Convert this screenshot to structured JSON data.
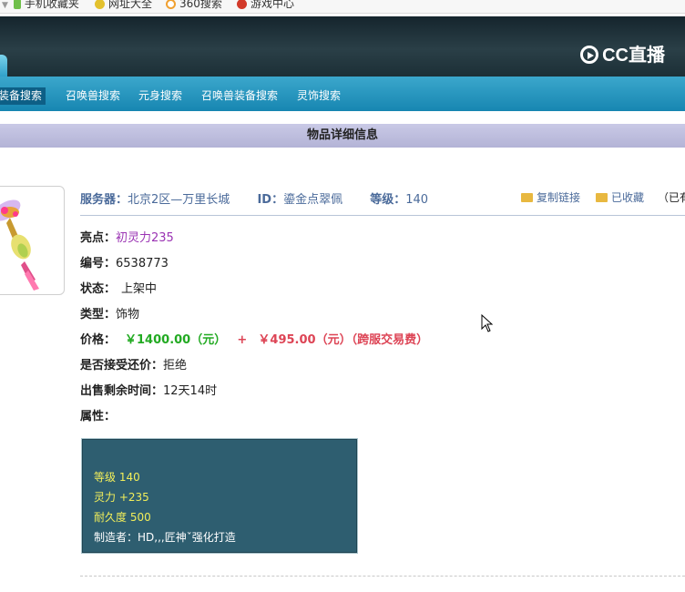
{
  "bookmarks": [
    {
      "label": "手机收藏夹",
      "icon": "phone-icon"
    },
    {
      "label": "网址大全",
      "icon": "star-icon"
    },
    {
      "label": "360搜索",
      "icon": "search-icon"
    },
    {
      "label": "游戏中心",
      "icon": "game-icon"
    }
  ],
  "logo": "CC直播",
  "nav": [
    "装备搜索",
    "召唤兽搜索",
    "元身搜索",
    "召唤兽装备搜索",
    "灵饰搜索"
  ],
  "page_title": "物品详细信息",
  "info": {
    "server_label": "服务器：",
    "server_value": "北京2区—万里长城",
    "id_label": "ID：",
    "id_value": "鎏金点翠佩",
    "level_label": "等级：",
    "level_value": "140",
    "copy_link": "复制链接",
    "favorited": "已收藏",
    "extra": "（已有"
  },
  "details": {
    "highlight_label": "亮点：",
    "highlight_value": "初灵力235",
    "number_label": "编号：",
    "number_value": "6538773",
    "status_label": "状态：",
    "status_value": "上架中",
    "type_label": "类型：",
    "type_value": "饰物",
    "price_label": "价格：",
    "price_value": "￥1400.00（元）",
    "price_plus": "+",
    "fee_value": "￥495.00（元）（跨服交易费）",
    "counter_label": "是否接受还价：",
    "counter_value": "拒绝",
    "remaining_label": "出售剩余时间：",
    "remaining_value": "12天14时",
    "attr_label": "属性："
  },
  "attributes": {
    "level": "等级 140",
    "spirit": "灵力 +235",
    "durability": "耐久度 500",
    "maker": "制造者：HD,,,匠神ˇ强化打造"
  },
  "colors": {
    "nav": "#1786b1",
    "title_bar": "#b3b3d6",
    "attr_box": "#2e5e70",
    "price_green": "#22aa22",
    "fee_red": "#dd4455"
  }
}
